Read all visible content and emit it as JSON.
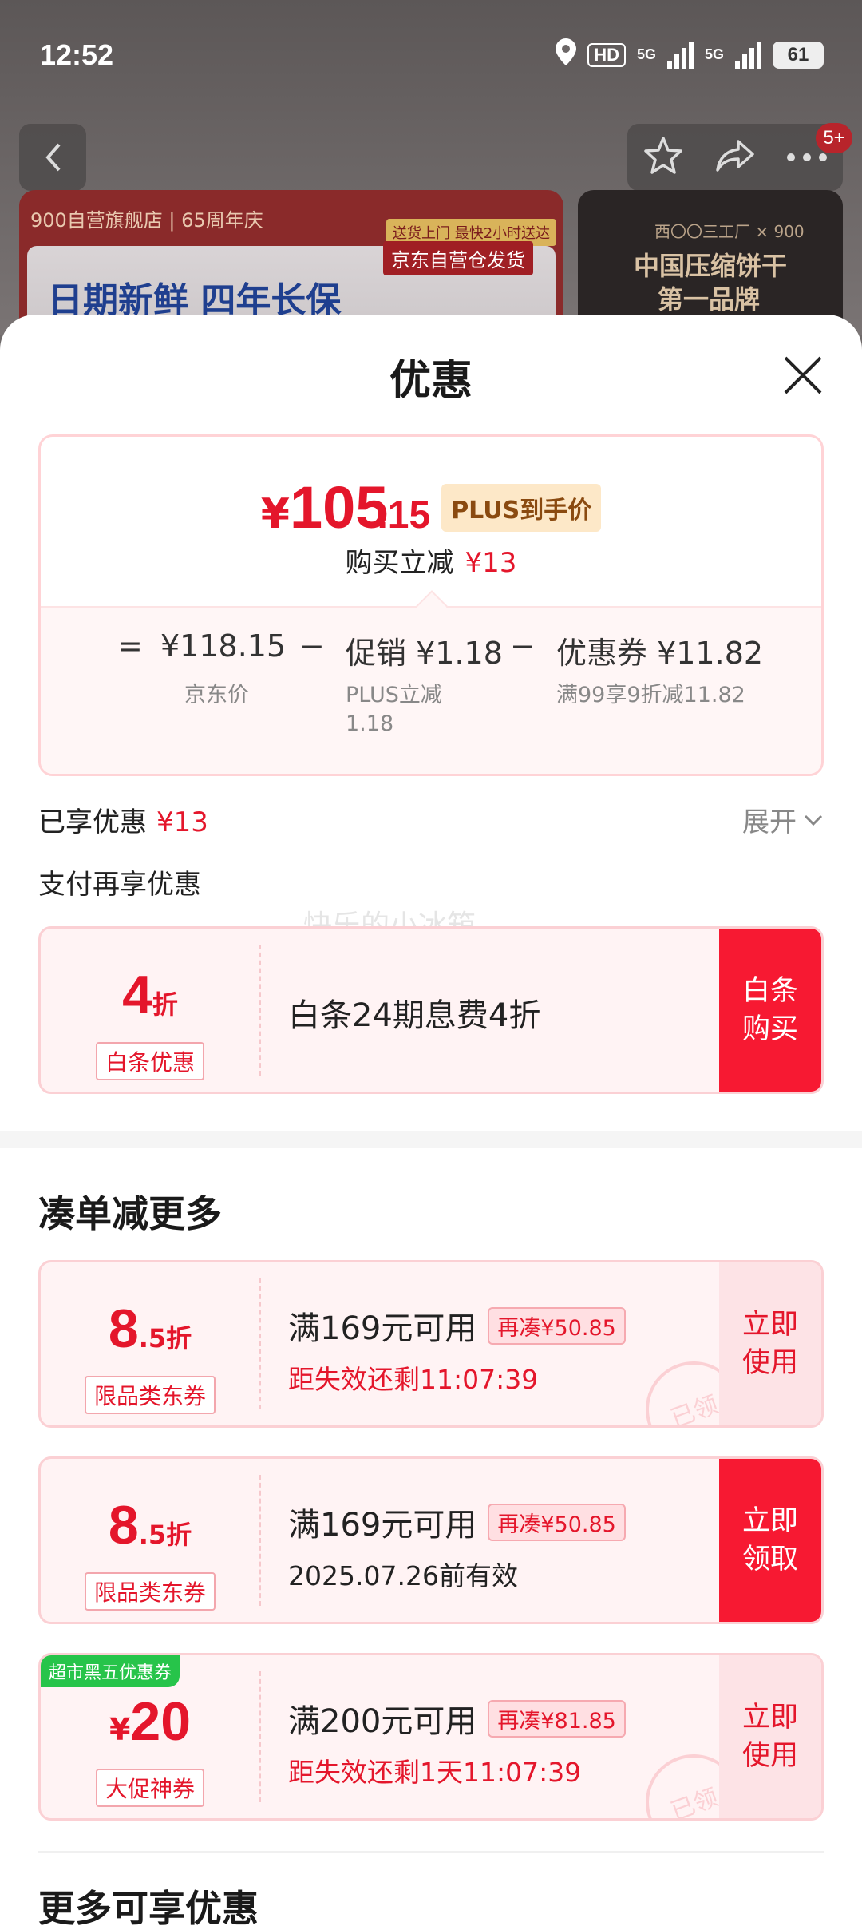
{
  "status": {
    "time": "12:52",
    "network1": "5G",
    "network2": "5G",
    "battery": "61",
    "hd": "HD"
  },
  "header": {
    "badge": "5+"
  },
  "banner_left": {
    "top_line": "900自营旗舰店 | 65周年庆",
    "slogan": "日期新鲜 四年长保",
    "tag1": "送货上门 最快2小时送达",
    "tag2": "京东自营仓发货"
  },
  "banner_right": {
    "brand": "西〇〇三工厂 × 900",
    "line1": "中国压缩饼干",
    "line2": "第一品牌"
  },
  "sheet": {
    "title": "优惠"
  },
  "price": {
    "yen": "¥",
    "int": "105",
    "dec": ".15",
    "plus_tag": "PLUS到手价",
    "reduce_label": "购买立减",
    "reduce_value": "¥13",
    "eq": "=",
    "jd_price": "¥118.15",
    "jd_label": "京东价",
    "minus1": "−",
    "promo": "促销 ¥1.18",
    "promo_label_1": "PLUS立减",
    "promo_label_2": "1.18",
    "minus2": "−",
    "coupon": "优惠券 ¥11.82",
    "coupon_label": "满99享9折减11.82"
  },
  "enjoyed": {
    "label": "已享优惠",
    "value": "¥13",
    "expand": "展开"
  },
  "pay_more": "支付再享优惠",
  "watermark": "快乐的小冰箱",
  "baitiao": {
    "num": "4",
    "unit": "折",
    "tag": "白条优惠",
    "desc": "白条24期息费4折",
    "action_1": "白条",
    "action_2": "购买"
  },
  "section_more": "凑单减更多",
  "coupons": [
    {
      "num": "8",
      "unit": ".5折",
      "tag": "限品类东券",
      "cond": "满169元可用",
      "pill": "再凑¥50.85",
      "sub": "距失效还剩11:07:39",
      "action_1": "立即",
      "action_2": "使用",
      "stamp": "已领"
    },
    {
      "num": "8",
      "unit": ".5折",
      "tag": "限品类东券",
      "cond": "满169元可用",
      "pill": "再凑¥50.85",
      "sub": "2025.07.26前有效",
      "action_1": "立即",
      "action_2": "领取"
    },
    {
      "corner": "超市黑五优惠券",
      "yen": "¥",
      "num": "20",
      "tag": "大促神券",
      "cond": "满200元可用",
      "pill": "再凑¥81.85",
      "sub": "距失效还剩1天11:07:39",
      "action_1": "立即",
      "action_2": "使用",
      "stamp": "已领"
    }
  ],
  "section_more2": "更多可享优惠",
  "colors": {
    "accent": "#e4162b",
    "button": "#f71932",
    "green": "#27c44a"
  }
}
